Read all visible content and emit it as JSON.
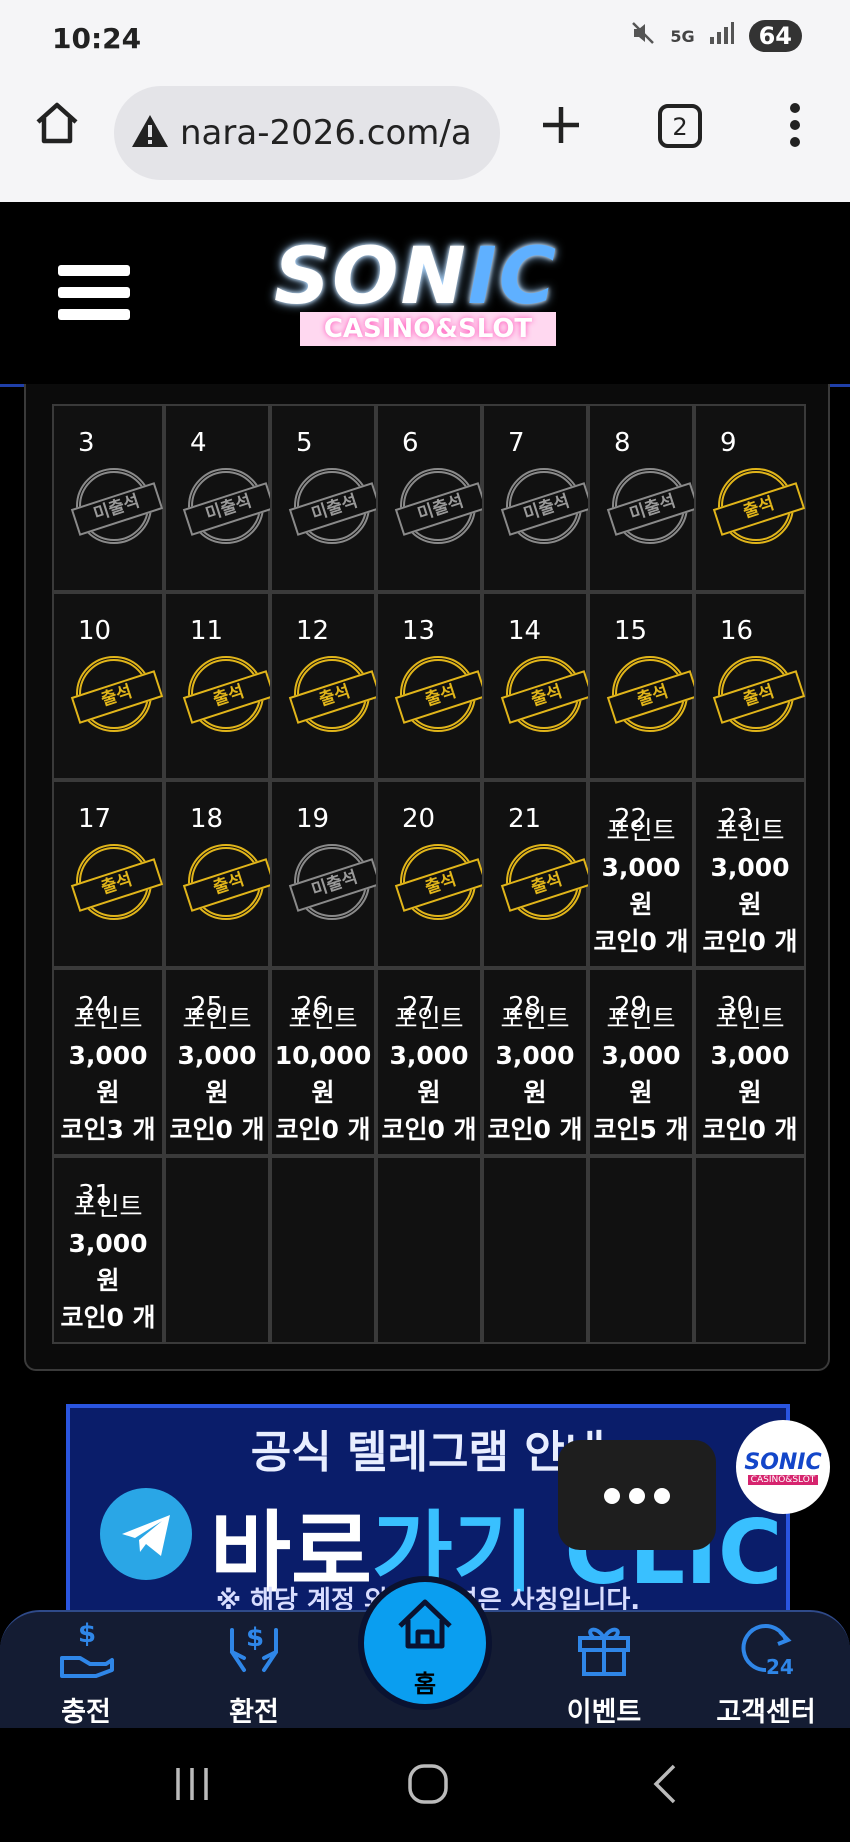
{
  "status_bar": {
    "time": "10:24",
    "network": "5G",
    "battery": "64"
  },
  "browser": {
    "url": "nara-2026.com/a",
    "tab_count": "2"
  },
  "site": {
    "logo_main": "SON",
    "logo_main_accent": "IC",
    "logo_sub": "CASINO&SLOT"
  },
  "calendar": {
    "rows": [
      [
        {
          "day": "3",
          "status": "미출석"
        },
        {
          "day": "4",
          "status": "미출석"
        },
        {
          "day": "5",
          "status": "미출석"
        },
        {
          "day": "6",
          "status": "미출석"
        },
        {
          "day": "7",
          "status": "미출석"
        },
        {
          "day": "8",
          "status": "미출석"
        },
        {
          "day": "9",
          "status": "출석"
        }
      ],
      [
        {
          "day": "10",
          "status": "출석"
        },
        {
          "day": "11",
          "status": "출석"
        },
        {
          "day": "12",
          "status": "출석"
        },
        {
          "day": "13",
          "status": "출석"
        },
        {
          "day": "14",
          "status": "출석"
        },
        {
          "day": "15",
          "status": "출석"
        },
        {
          "day": "16",
          "status": "출석"
        }
      ],
      [
        {
          "day": "17",
          "status": "출석"
        },
        {
          "day": "18",
          "status": "출석"
        },
        {
          "day": "19",
          "status": "미출석"
        },
        {
          "day": "20",
          "status": "출석"
        },
        {
          "day": "21",
          "status": "출석"
        },
        {
          "day": "22",
          "points_label": "포인트",
          "points": "3,000",
          "won": "원",
          "coins": "코인0 개"
        },
        {
          "day": "23",
          "points_label": "포인트",
          "points": "3,000 원",
          "won": "",
          "coins": "코인0 개"
        }
      ],
      [
        {
          "day": "24",
          "points_label": "포인트",
          "points": "3,000 원",
          "won": "",
          "coins": "코인3 개"
        },
        {
          "day": "25",
          "points_label": "포인트",
          "points": "3,000",
          "won": "원",
          "coins": "코인0 개"
        },
        {
          "day": "26",
          "points_label": "포인트",
          "points": "10,000",
          "won": "원",
          "coins": "코인0 개"
        },
        {
          "day": "27",
          "points_label": "포인트",
          "points": "3,000",
          "won": "원",
          "coins": "코인0 개"
        },
        {
          "day": "28",
          "points_label": "포인트",
          "points": "3,000",
          "won": "원",
          "coins": "코인0 개"
        },
        {
          "day": "29",
          "points_label": "포인트",
          "points": "3,000",
          "won": "원",
          "coins": "코인5 개"
        },
        {
          "day": "30",
          "points_label": "포인트",
          "points": "3,000 원",
          "won": "",
          "coins": "코인0 개"
        }
      ],
      [
        {
          "day": "31",
          "points_label": "포인트",
          "points": "3,000 원",
          "won": "",
          "coins": "코인0 개"
        },
        {
          "day": ""
        },
        {
          "day": ""
        },
        {
          "day": ""
        },
        {
          "day": ""
        },
        {
          "day": ""
        },
        {
          "day": ""
        }
      ]
    ]
  },
  "banner": {
    "title": "공식 텔레그램 안내",
    "go_white": "바로",
    "go_blue": "가기 CLICK",
    "note": "※ 해당 계정 외 본 채널은 사칭입니다."
  },
  "fab": {
    "title": "SONIC",
    "sub": "CASINO&SLOT"
  },
  "bottom_nav": {
    "deposit": "충전",
    "withdraw": "환전",
    "home": "홈",
    "event": "이벤트",
    "support": "고객센터"
  },
  "colors": {
    "accent_blue": "#0a9ef0",
    "attend_gold": "#e1b51a",
    "absent_gray": "#8a8a8a"
  }
}
